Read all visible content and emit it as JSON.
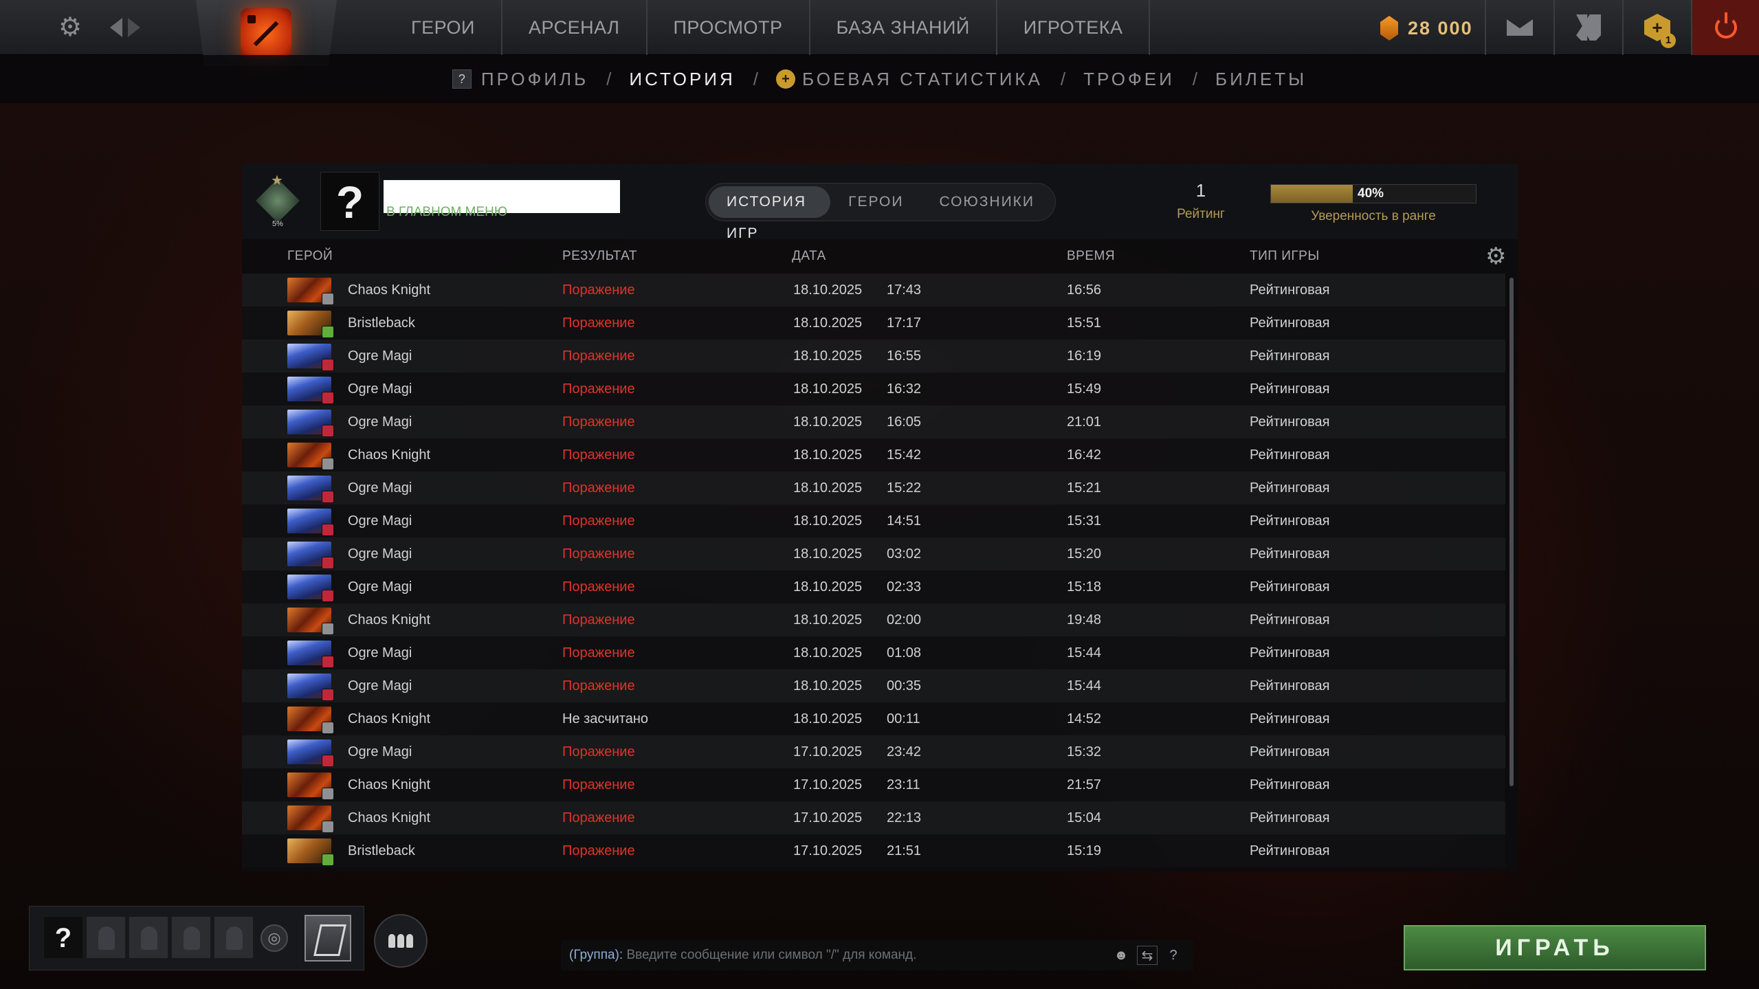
{
  "topbar": {
    "nav": [
      "ГЕРОИ",
      "АРСЕНАЛ",
      "ПРОСМОТР",
      "БАЗА ЗНАНИЙ",
      "ИГРОТЕКА"
    ],
    "shards": "28 000",
    "plus_badge": "1"
  },
  "subnav": {
    "profile_icon": "?",
    "items": [
      "ПРОФИЛЬ",
      "ИСТОРИЯ",
      "БОЕВАЯ СТАТИСТИКА",
      "ТРОФЕИ",
      "БИЛЕТЫ"
    ],
    "separator": "/",
    "active": "ИСТОРИЯ"
  },
  "profile": {
    "avatar": "?",
    "status": "В ГЛАВНОМ МЕНЮ",
    "medal_percent": "5%"
  },
  "tabs": [
    "ИСТОРИЯ ИГР",
    "ГЕРОИ",
    "СОЮЗНИКИ"
  ],
  "rating": {
    "value": "1",
    "label": "Рейтинг"
  },
  "confidence": {
    "percent": "40%",
    "fraction": 0.4,
    "label": "Уверенность в ранге"
  },
  "table": {
    "headers": {
      "hero": "ГЕРОЙ",
      "result": "РЕЗУЛЬТАТ",
      "date": "ДАТА",
      "duration": "ВРЕМЯ",
      "type": "ТИП ИГРЫ"
    },
    "rows": [
      {
        "hero": "Chaos Knight",
        "icon": "chaos",
        "role": "grey",
        "result": "Поражение",
        "loss": true,
        "date": "18.10.2025",
        "time": "17:43",
        "duration": "16:56",
        "type": "Рейтинговая"
      },
      {
        "hero": "Bristleback",
        "icon": "bristle",
        "role": "green",
        "result": "Поражение",
        "loss": true,
        "date": "18.10.2025",
        "time": "17:17",
        "duration": "15:51",
        "type": "Рейтинговая"
      },
      {
        "hero": "Ogre Magi",
        "icon": "ogre",
        "role": "red",
        "result": "Поражение",
        "loss": true,
        "date": "18.10.2025",
        "time": "16:55",
        "duration": "16:19",
        "type": "Рейтинговая"
      },
      {
        "hero": "Ogre Magi",
        "icon": "ogre",
        "role": "red",
        "result": "Поражение",
        "loss": true,
        "date": "18.10.2025",
        "time": "16:32",
        "duration": "15:49",
        "type": "Рейтинговая"
      },
      {
        "hero": "Ogre Magi",
        "icon": "ogre",
        "role": "red",
        "result": "Поражение",
        "loss": true,
        "date": "18.10.2025",
        "time": "16:05",
        "duration": "21:01",
        "type": "Рейтинговая"
      },
      {
        "hero": "Chaos Knight",
        "icon": "chaos",
        "role": "grey",
        "result": "Поражение",
        "loss": true,
        "date": "18.10.2025",
        "time": "15:42",
        "duration": "16:42",
        "type": "Рейтинговая"
      },
      {
        "hero": "Ogre Magi",
        "icon": "ogre",
        "role": "red",
        "result": "Поражение",
        "loss": true,
        "date": "18.10.2025",
        "time": "15:22",
        "duration": "15:21",
        "type": "Рейтинговая"
      },
      {
        "hero": "Ogre Magi",
        "icon": "ogre",
        "role": "red",
        "result": "Поражение",
        "loss": true,
        "date": "18.10.2025",
        "time": "14:51",
        "duration": "15:31",
        "type": "Рейтинговая"
      },
      {
        "hero": "Ogre Magi",
        "icon": "ogre",
        "role": "red",
        "result": "Поражение",
        "loss": true,
        "date": "18.10.2025",
        "time": "03:02",
        "duration": "15:20",
        "type": "Рейтинговая"
      },
      {
        "hero": "Ogre Magi",
        "icon": "ogre",
        "role": "red",
        "result": "Поражение",
        "loss": true,
        "date": "18.10.2025",
        "time": "02:33",
        "duration": "15:18",
        "type": "Рейтинговая"
      },
      {
        "hero": "Chaos Knight",
        "icon": "chaos",
        "role": "grey",
        "result": "Поражение",
        "loss": true,
        "date": "18.10.2025",
        "time": "02:00",
        "duration": "19:48",
        "type": "Рейтинговая"
      },
      {
        "hero": "Ogre Magi",
        "icon": "ogre",
        "role": "red",
        "result": "Поражение",
        "loss": true,
        "date": "18.10.2025",
        "time": "01:08",
        "duration": "15:44",
        "type": "Рейтинговая"
      },
      {
        "hero": "Ogre Magi",
        "icon": "ogre",
        "role": "red",
        "result": "Поражение",
        "loss": true,
        "date": "18.10.2025",
        "time": "00:35",
        "duration": "15:44",
        "type": "Рейтинговая"
      },
      {
        "hero": "Chaos Knight",
        "icon": "chaos",
        "role": "grey",
        "result": "Не засчитано",
        "loss": false,
        "date": "18.10.2025",
        "time": "00:11",
        "duration": "14:52",
        "type": "Рейтинговая"
      },
      {
        "hero": "Ogre Magi",
        "icon": "ogre",
        "role": "red",
        "result": "Поражение",
        "loss": true,
        "date": "17.10.2025",
        "time": "23:42",
        "duration": "15:32",
        "type": "Рейтинговая"
      },
      {
        "hero": "Chaos Knight",
        "icon": "chaos",
        "role": "grey",
        "result": "Поражение",
        "loss": true,
        "date": "17.10.2025",
        "time": "23:11",
        "duration": "21:57",
        "type": "Рейтинговая"
      },
      {
        "hero": "Chaos Knight",
        "icon": "chaos",
        "role": "grey",
        "result": "Поражение",
        "loss": true,
        "date": "17.10.2025",
        "time": "22:13",
        "duration": "15:04",
        "type": "Рейтинговая"
      },
      {
        "hero": "Bristleback",
        "icon": "bristle",
        "role": "green",
        "result": "Поражение",
        "loss": true,
        "date": "17.10.2025",
        "time": "21:51",
        "duration": "15:19",
        "type": "Рейтинговая"
      }
    ]
  },
  "bottom": {
    "party_me": "?",
    "chat_channel": "(Группа):",
    "chat_placeholder": "Введите сообщение или символ \"/\" для команд.",
    "chat_help": "?",
    "play": "ИГРАТЬ"
  },
  "colors": {
    "loss": "#e0332a",
    "accent_gold": "#b59a5a",
    "play_green": "#4c8a44"
  }
}
